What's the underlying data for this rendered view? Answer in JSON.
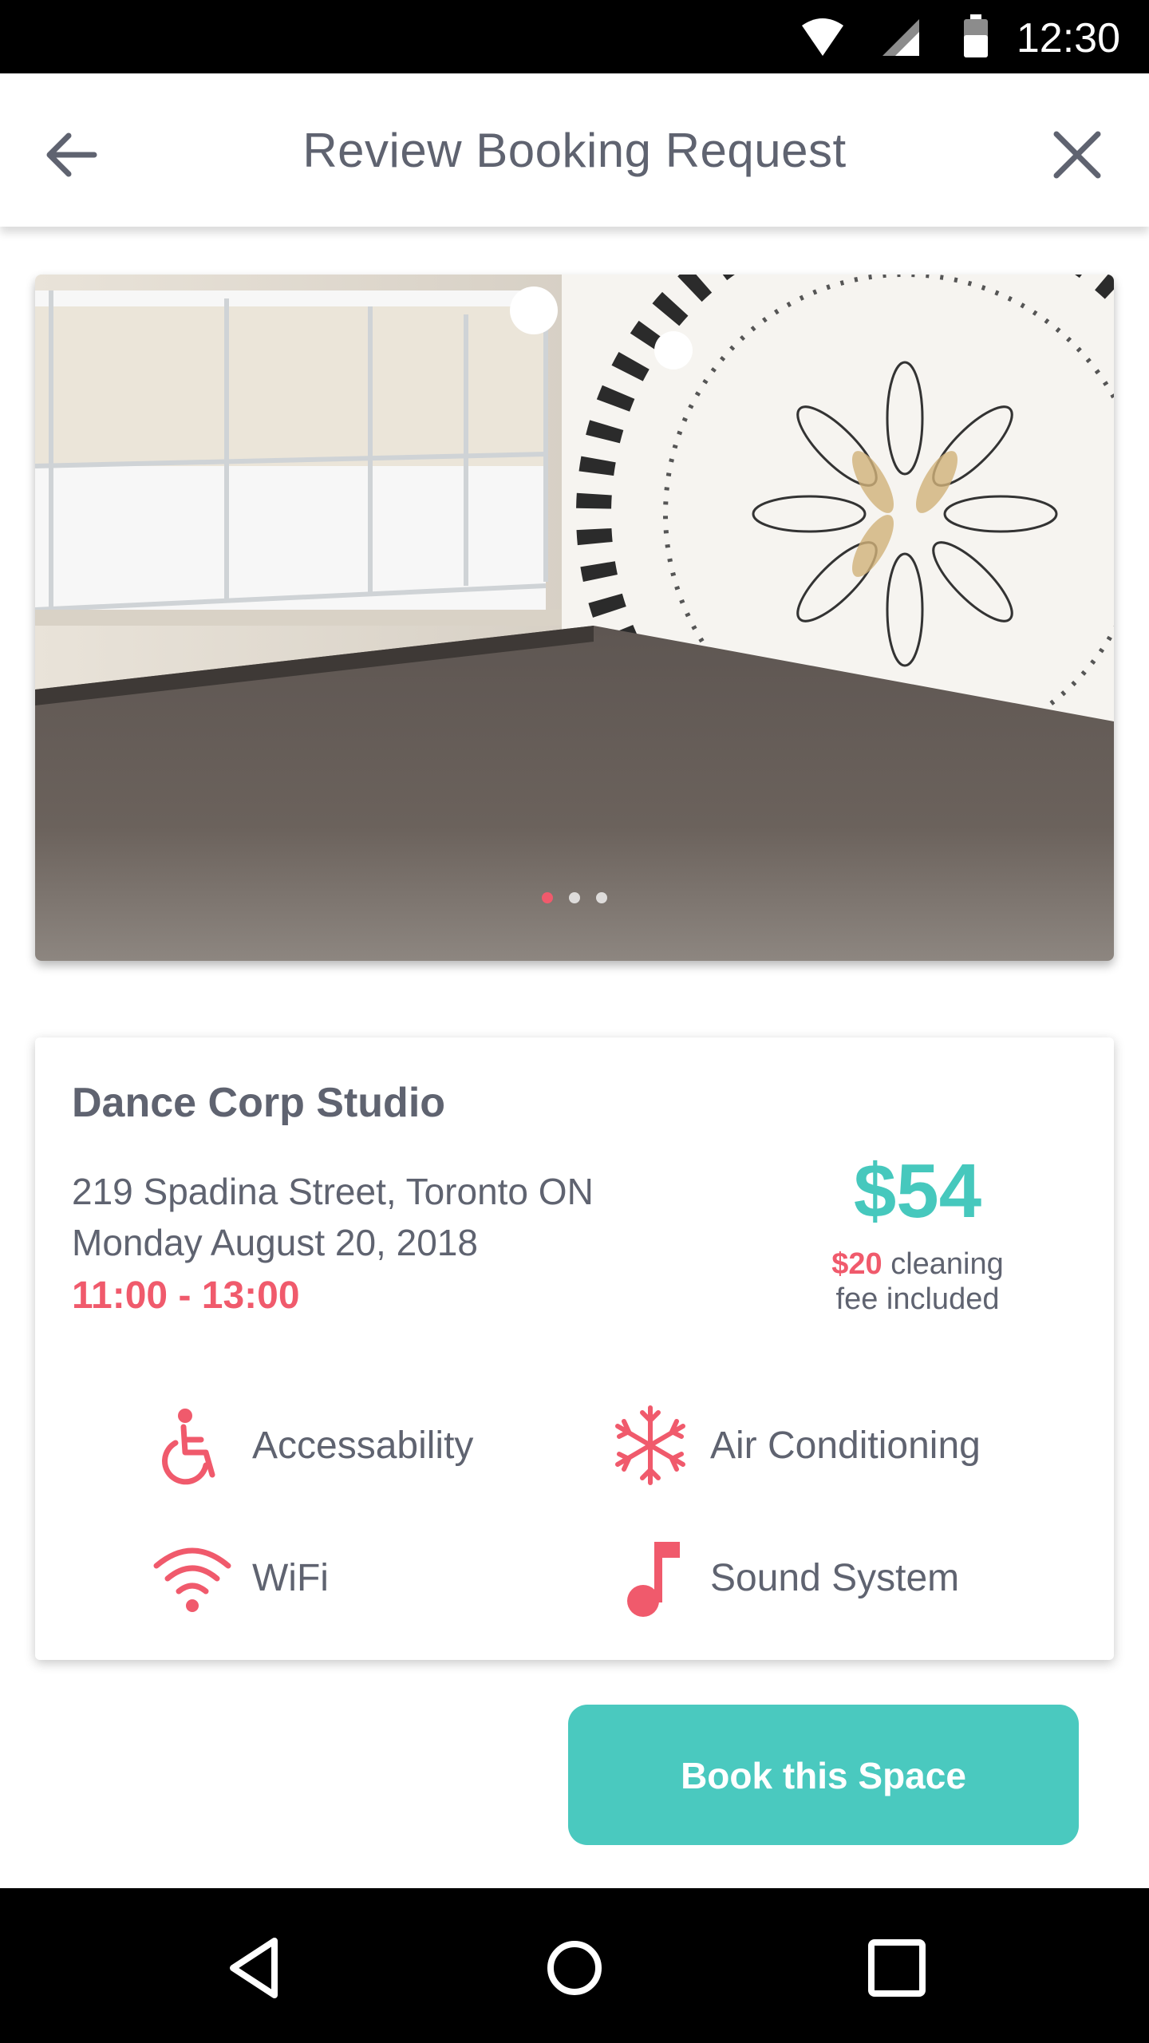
{
  "status_bar": {
    "time": "12:30",
    "icons": [
      "wifi-icon",
      "cellular-signal-icon",
      "battery-icon"
    ]
  },
  "app_bar": {
    "title": "Review Booking Request",
    "back_icon": "arrow-left-icon",
    "close_icon": "close-icon"
  },
  "gallery": {
    "image": "studio-photo",
    "page_count": 3,
    "active_page": 1
  },
  "listing": {
    "name": "Dance Corp Studio",
    "address": "219 Spadina Street, Toronto ON",
    "date": "Monday August 20, 2018",
    "time_start": "11:00",
    "time_separator": " - ",
    "time_end": "13:00",
    "price": "$54",
    "fee_amount": "$20",
    "fee_text_1": " cleaning",
    "fee_text_2": "fee included"
  },
  "amenities": [
    {
      "label": "Accessability",
      "icon": "wheelchair-icon"
    },
    {
      "label": "Air Conditioning",
      "icon": "snowflake-icon"
    },
    {
      "label": "WiFi",
      "icon": "wifi-icon"
    },
    {
      "label": "Sound System",
      "icon": "music-note-icon"
    }
  ],
  "actions": {
    "book_label": "Book this Space"
  },
  "nav_bar": {
    "icons": [
      "back-triangle-icon",
      "home-circle-icon",
      "recents-square-icon"
    ]
  },
  "colors": {
    "accent_pink": "#f05a6c",
    "accent_teal": "#46c8bd",
    "text_gray": "#5f6370"
  }
}
